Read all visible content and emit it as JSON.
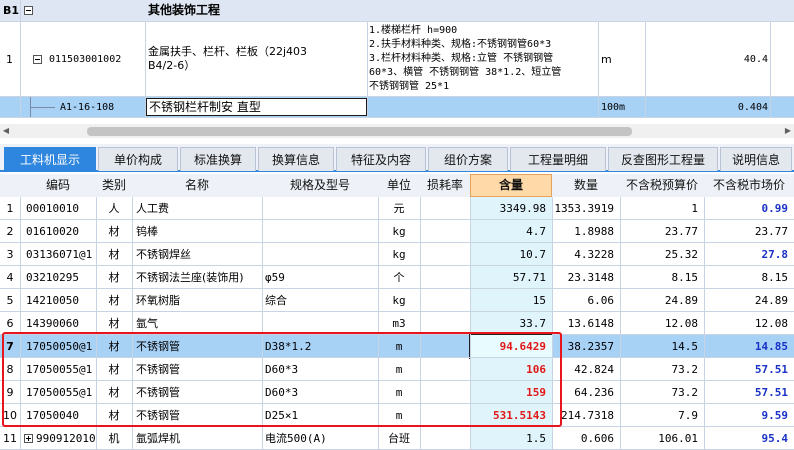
{
  "top": {
    "b1": {
      "label": "B1",
      "title": "其他装饰工程"
    },
    "row1": {
      "index": "1",
      "code": "011503001002",
      "name_line1": "金属扶手、栏杆、栏板（22j403",
      "name_line2": "B4/2-6）",
      "desc": [
        "1.楼梯栏杆 h=900",
        "2.扶手材料种类、规格:不锈钢钢管60*3",
        "3.栏杆材料种类、规格:立管 不锈钢钢管",
        "60*3、横管 不锈钢钢管 38*1.2、短立管",
        "不锈钢钢管 25*1"
      ],
      "unit": "m",
      "qty": "40.4"
    },
    "row2": {
      "code": "A1-16-108",
      "name": "不锈钢栏杆制安 直型",
      "unit": "100m",
      "qty": "0.404"
    }
  },
  "tabs": [
    {
      "label": "工料机显示"
    },
    {
      "label": "单价构成"
    },
    {
      "label": "标准换算"
    },
    {
      "label": "换算信息"
    },
    {
      "label": "特征及内容"
    },
    {
      "label": "组价方案"
    },
    {
      "label": "工程量明细"
    },
    {
      "label": "反查图形工程量"
    },
    {
      "label": "说明信息"
    }
  ],
  "columns": [
    "编码",
    "类别",
    "名称",
    "规格及型号",
    "单位",
    "损耗率",
    "含量",
    "数量",
    "不含税预算价",
    "不含税市场价"
  ],
  "rows": [
    {
      "n": "1",
      "code": "00010010",
      "cat": "人",
      "name": "人工费",
      "spec": "",
      "unit": "元",
      "loss": "",
      "content": "3349.98",
      "qty": "1353.3919",
      "budget": "1",
      "market": "0.99"
    },
    {
      "n": "2",
      "code": "01610020",
      "cat": "材",
      "name": "钨棒",
      "spec": "",
      "unit": "kg",
      "loss": "",
      "content": "4.7",
      "qty": "1.8988",
      "budget": "23.77",
      "market": "23.77"
    },
    {
      "n": "3",
      "code": "03136071@1",
      "cat": "材",
      "name": "不锈钢焊丝",
      "spec": "",
      "unit": "kg",
      "loss": "",
      "content": "10.7",
      "qty": "4.3228",
      "budget": "25.32",
      "market": "27.8"
    },
    {
      "n": "4",
      "code": "03210295",
      "cat": "材",
      "name": "不锈钢法兰座(装饰用)",
      "spec": "φ59",
      "unit": "个",
      "loss": "",
      "content": "57.71",
      "qty": "23.3148",
      "budget": "8.15",
      "market": "8.15"
    },
    {
      "n": "5",
      "code": "14210050",
      "cat": "材",
      "name": "环氧树脂",
      "spec": "综合",
      "unit": "kg",
      "loss": "",
      "content": "15",
      "qty": "6.06",
      "budget": "24.89",
      "market": "24.89"
    },
    {
      "n": "6",
      "code": "14390060",
      "cat": "材",
      "name": "氩气",
      "spec": "",
      "unit": "m3",
      "loss": "",
      "content": "33.7",
      "qty": "13.6148",
      "budget": "12.08",
      "market": "12.08"
    },
    {
      "n": "7",
      "code": "17050050@1",
      "cat": "材",
      "name": "不锈钢管",
      "spec": "D38*1.2",
      "unit": "m",
      "loss": "",
      "content": "94.6429",
      "qty": "38.2357",
      "budget": "14.5",
      "market": "14.85"
    },
    {
      "n": "8",
      "code": "17050055@1",
      "cat": "材",
      "name": "不锈钢管",
      "spec": "D60*3",
      "unit": "m",
      "loss": "",
      "content": "106",
      "qty": "42.824",
      "budget": "73.2",
      "market": "57.51"
    },
    {
      "n": "9",
      "code": "17050055@1",
      "cat": "材",
      "name": "不锈钢管",
      "spec": "D60*3",
      "unit": "m",
      "loss": "",
      "content": "159",
      "qty": "64.236",
      "budget": "73.2",
      "market": "57.51"
    },
    {
      "n": "10",
      "code": "17050040",
      "cat": "材",
      "name": "不锈钢管",
      "spec": "D25×1",
      "unit": "m",
      "loss": "",
      "content": "531.5143",
      "qty": "214.7318",
      "budget": "7.9",
      "market": "9.59"
    },
    {
      "n": "11",
      "code": "990912010",
      "cat": "机",
      "name": "氩弧焊机",
      "spec": "电流500(A)",
      "unit": "台班",
      "loss": "",
      "content": "1.5",
      "qty": "0.606",
      "budget": "106.01",
      "market": "95.4"
    }
  ],
  "colors": {
    "accent": "#2f86de",
    "selected_row": "#a8d1f6",
    "header_active": "#ffd9a8",
    "content_cell": "#dff4fb",
    "frame": "#e8141e",
    "bold_red": "#e01818",
    "bold_blue": "#1a32c8"
  }
}
